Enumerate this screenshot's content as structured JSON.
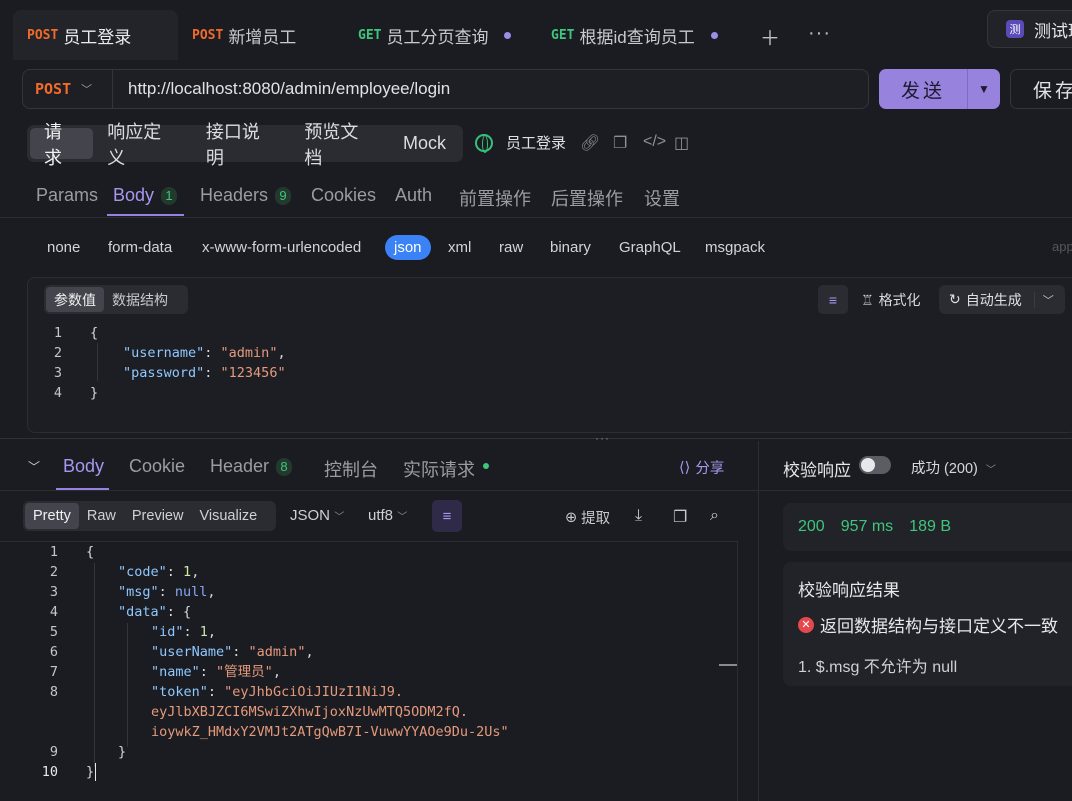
{
  "tabs": [
    {
      "method": "POST",
      "label": "员工登录"
    },
    {
      "method": "POST",
      "label": "新增员工"
    },
    {
      "method": "GET",
      "label": "员工分页查询"
    },
    {
      "method": "GET",
      "label": "根据id查询员工"
    }
  ],
  "env": {
    "badge": "测",
    "label": "测试环"
  },
  "request": {
    "method": "POST",
    "url": "http://localhost:8080/admin/employee/login",
    "send_label": "发送",
    "save_label": "保存"
  },
  "subtabs": [
    "请求",
    "响应定义",
    "接口说明",
    "预览文档",
    "Mock"
  ],
  "api_name": "员工登录",
  "param_tabs": {
    "params": "Params",
    "body": "Body",
    "body_count": "1",
    "headers": "Headers",
    "headers_count": "9",
    "cookies": "Cookies",
    "auth": "Auth",
    "pre": "前置操作",
    "post": "后置操作",
    "settings": "设置"
  },
  "body_types": [
    "none",
    "form-data",
    "x-www-form-urlencoded",
    "json",
    "xml",
    "raw",
    "binary",
    "GraphQL",
    "msgpack"
  ],
  "body_types_overflow": "app",
  "editor": {
    "tab_params": "参数值",
    "tab_schema": "数据结构",
    "format_label": "格式化",
    "autogen_label": "自动生成",
    "lines": [
      {
        "n": "1",
        "text": "{"
      },
      {
        "n": "2",
        "key": "\"username\"",
        "val": "\"admin\"",
        "tail": ","
      },
      {
        "n": "3",
        "key": "\"password\"",
        "val": "\"123456\"",
        "tail": ""
      },
      {
        "n": "4",
        "text": "}"
      }
    ]
  },
  "response": {
    "tabs": {
      "body": "Body",
      "cookie": "Cookie",
      "header": "Header",
      "header_count": "8",
      "console": "控制台",
      "actual": "实际请求"
    },
    "share": "分享",
    "views": [
      "Pretty",
      "Raw",
      "Preview",
      "Visualize"
    ],
    "format": "JSON",
    "encoding": "utf8",
    "extract": "提取",
    "lines": [
      {
        "n": "1",
        "text": "{"
      },
      {
        "n": "2",
        "key": "\"code\"",
        "val": "1",
        "type": "num",
        "tail": ","
      },
      {
        "n": "3",
        "key": "\"msg\"",
        "val": "null",
        "type": "null",
        "tail": ","
      },
      {
        "n": "4",
        "key": "\"data\"",
        "val": "{",
        "type": "punct",
        "tail": ""
      },
      {
        "n": "5",
        "key": "\"id\"",
        "val": "1",
        "type": "num",
        "tail": ",",
        "indent": 2
      },
      {
        "n": "6",
        "key": "\"userName\"",
        "val": "\"admin\"",
        "type": "str",
        "tail": ",",
        "indent": 2
      },
      {
        "n": "7",
        "key": "\"name\"",
        "val": "\"管理员\"",
        "type": "str",
        "tail": ",",
        "indent": 2
      },
      {
        "n": "8",
        "key": "\"token\"",
        "val": "\"eyJhbGciOiJIUzI1NiJ9.",
        "type": "str",
        "tail": "",
        "indent": 2
      },
      {
        "n": "",
        "cont": "eyJlbXBJZCI6MSwiZXhwIjoxNzUwMTQ5ODM2fQ."
      },
      {
        "n": "",
        "cont": "ioywkZ_HMdxY2VMJt2ATgQwB7I-VuwwYYAOe9Du-2Us\""
      },
      {
        "n": "9",
        "text": "}",
        "indent": 1
      },
      {
        "n": "10",
        "text": "}"
      }
    ]
  },
  "validation": {
    "title": "校验响应",
    "status_label": "成功 (200)",
    "status_code": "200",
    "time": "957 ms",
    "size": "189 B",
    "result_title": "校验响应结果",
    "error": "返回数据结构与接口定义不一致",
    "error_detail": "1. $.msg 不允许为 null"
  }
}
